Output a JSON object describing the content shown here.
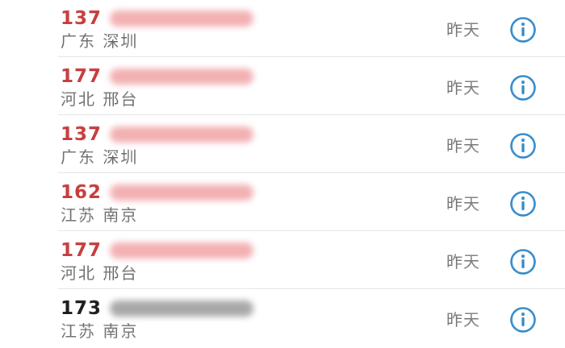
{
  "colors": {
    "accent": "#2f88c9",
    "red_prefix": "#c53a3a",
    "dark_prefix": "#1a1a1a",
    "red_blur": "#f0a3a6",
    "gray_blur": "#9a9a9a"
  },
  "icons": {
    "info": "info-circle-icon"
  },
  "calls": [
    {
      "prefix": "137",
      "location": "广东 深圳",
      "time": "昨天",
      "highlight": true
    },
    {
      "prefix": "177",
      "location": "河北 邢台",
      "time": "昨天",
      "highlight": true
    },
    {
      "prefix": "137",
      "location": "广东 深圳",
      "time": "昨天",
      "highlight": true
    },
    {
      "prefix": "162",
      "location": "江苏 南京",
      "time": "昨天",
      "highlight": true
    },
    {
      "prefix": "177",
      "location": "河北 邢台",
      "time": "昨天",
      "highlight": true
    },
    {
      "prefix": "173",
      "location": "江苏 南京",
      "time": "昨天",
      "highlight": false
    }
  ]
}
